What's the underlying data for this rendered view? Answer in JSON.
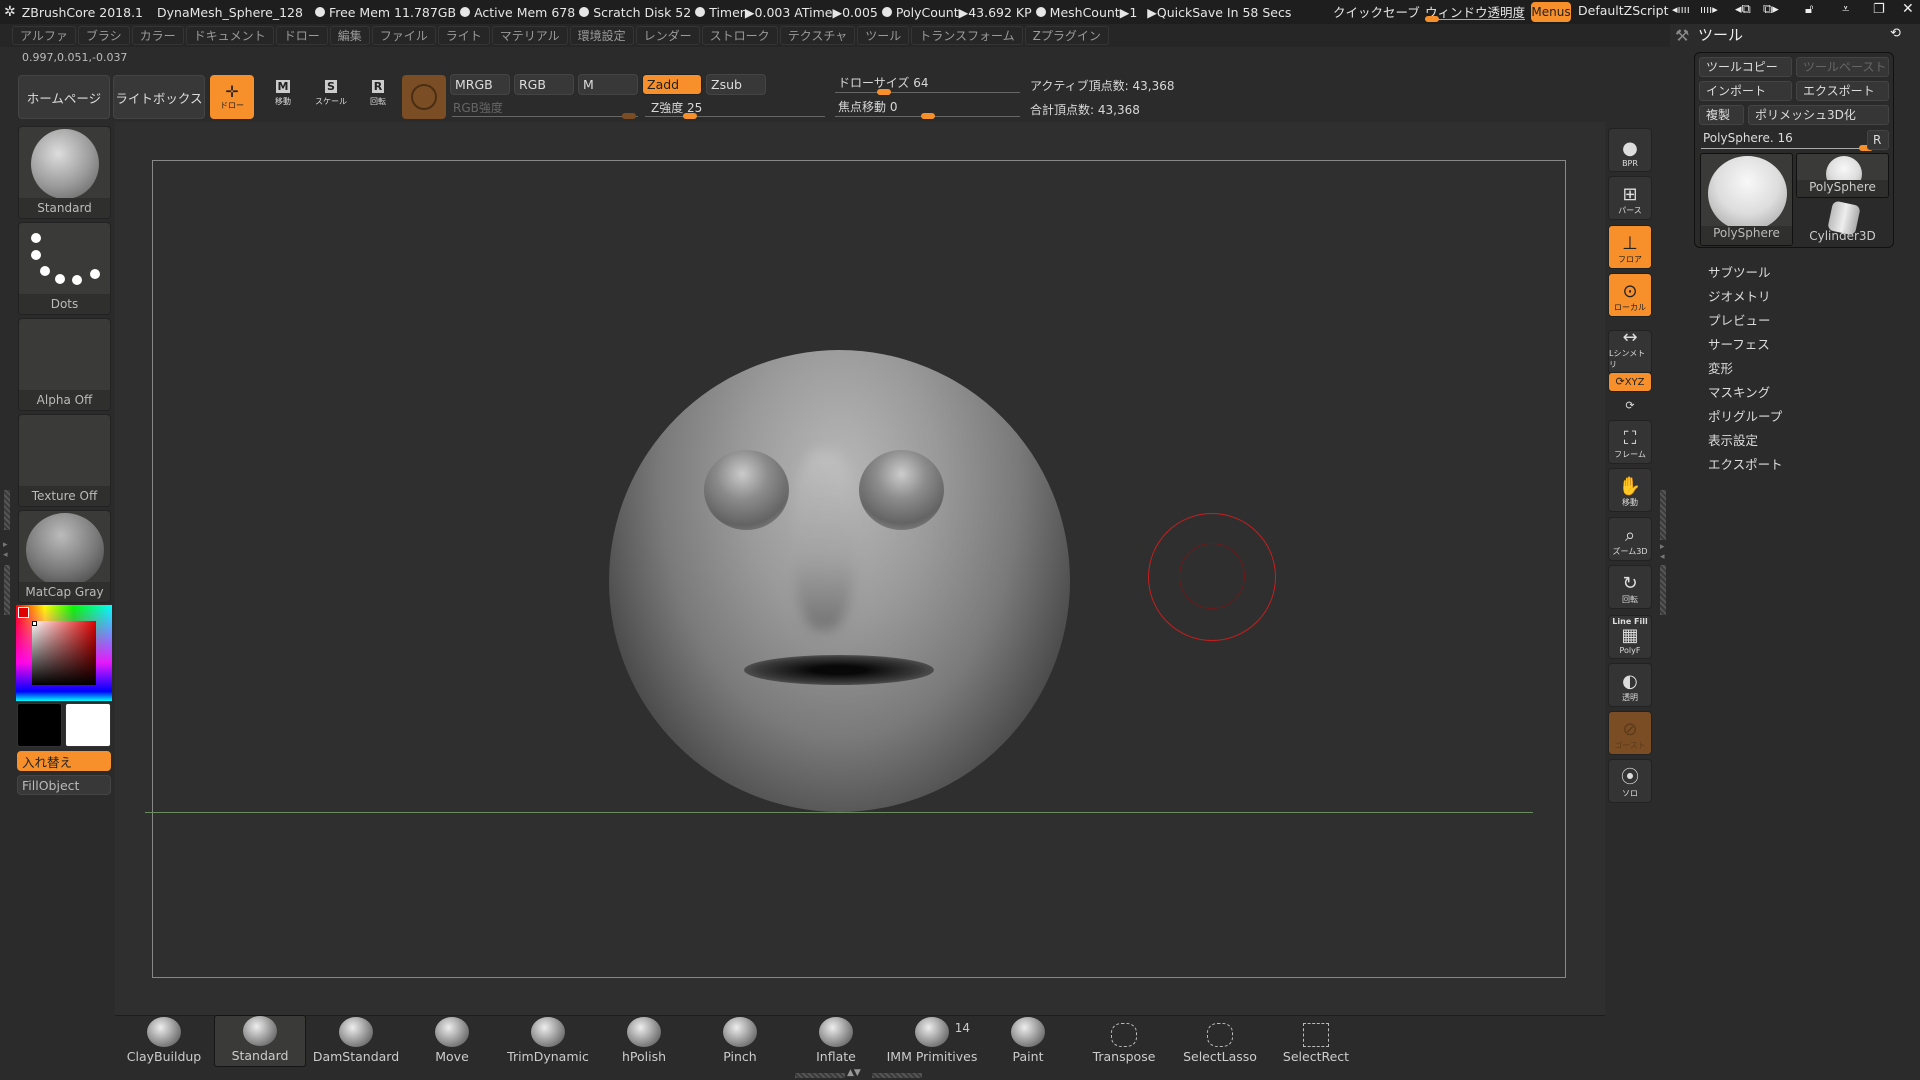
{
  "titlebar": {
    "app": "ZBrushCore 2018.1",
    "document": "DynaMesh_Sphere_128",
    "stats": [
      "Free Mem 11.787GB",
      "Active Mem 678",
      "Scratch Disk 52",
      "Timer▶0.003 ATime▶0.005",
      "PolyCount▶43.692 KP",
      "MeshCount▶1"
    ],
    "quicksave": "▶QuickSave In 58 Secs",
    "quicksave_button": "クイックセーブ",
    "window_transparency": "ウィンドウ透明度",
    "menus_button": "Menus",
    "default_zscript": "DefaultZScript"
  },
  "menubar": [
    "アルファ",
    "ブラシ",
    "カラー",
    "ドキュメント",
    "ドロー",
    "編集",
    "ファイル",
    "ライト",
    "マテリアル",
    "環境設定",
    "レンダー",
    "ストローク",
    "テクスチャ",
    "ツール",
    "トランスフォーム",
    "Zプラグイン"
  ],
  "coords": "0.997,0.051,-0.037",
  "toolbar": {
    "homepage": "ホームページ",
    "lightbox": "ライトボックス",
    "draw": "ドロー",
    "move": "移動",
    "scale": "スケール",
    "rotate": "回転",
    "mrgb": "MRGB",
    "rgb": "RGB",
    "m": "M",
    "zadd": "Zadd",
    "zsub": "Zsub",
    "rgb_intensity_label": "RGB強度",
    "z_intensity_label": "Z強度 25",
    "z_intensity": 25,
    "draw_size_label": "ドローサイズ 64",
    "draw_size": 64,
    "focal_shift_label": "焦点移動 0",
    "focal_shift": 0,
    "active_points": "アクティブ頂点数: 43,368",
    "total_points": "合計頂点数: 43,368"
  },
  "left_panel": {
    "brush": "Standard",
    "stroke": "Dots",
    "alpha": "Alpha Off",
    "texture": "Texture Off",
    "material": "MatCap Gray",
    "main_color": "#e00000",
    "swap_button": "入れ替え",
    "fill_object": "FillObject"
  },
  "right_shelf": [
    "BPR",
    "パース",
    "フロア",
    "ローカル",
    "Lシンメトリ",
    "XYZ",
    "Y",
    "フレーム",
    "移動",
    "ズーム3D",
    "回転",
    "PolyF",
    "透明",
    "ゴースト",
    "ソロ"
  ],
  "right_shelf_linefill": "Line Fill",
  "tool_panel": {
    "title": "ツール",
    "tool_copy": "ツールコピー",
    "tool_paste": "ツールペースト",
    "import": "インポート",
    "export": "エクスポート",
    "clone": "複製",
    "make_polymesh": "ポリメッシュ3D化",
    "current_tool_label": "PolySphere. 16",
    "r_button": "R",
    "tools": [
      "PolySphere",
      "PolySphere",
      "Cylinder3D"
    ],
    "sections": [
      "サブツール",
      "ジオメトリ",
      "プレビュー",
      "サーフェス",
      "変形",
      "マスキング",
      "ポリグループ",
      "表示設定",
      "エクスポート"
    ]
  },
  "brushes": [
    {
      "name": "ClayBuildup"
    },
    {
      "name": "Standard",
      "selected": true
    },
    {
      "name": "DamStandard"
    },
    {
      "name": "Move"
    },
    {
      "name": "TrimDynamic"
    },
    {
      "name": "hPolish"
    },
    {
      "name": "Pinch"
    },
    {
      "name": "Inflate"
    },
    {
      "name": "IMM Primitives",
      "badge": "14"
    },
    {
      "name": "Paint"
    },
    {
      "name": "Transpose"
    },
    {
      "name": "SelectLasso"
    },
    {
      "name": "SelectRect"
    }
  ],
  "colors": {
    "accent": "#f7902a",
    "brown": "#7a4d24",
    "cursor": "#c81e1e"
  }
}
